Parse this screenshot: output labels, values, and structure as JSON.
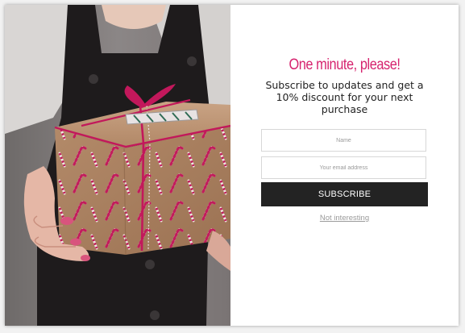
{
  "popup": {
    "headline": "One minute, please!",
    "subline": "Subscribe to updates and get a 10% discount for your next purchase",
    "name_field": {
      "placeholder": "Name",
      "value": ""
    },
    "email_field": {
      "placeholder": "Your email address",
      "value": ""
    },
    "subscribe_label": "SUBSCRIBE",
    "dismiss_label": "Not interesting"
  },
  "image": {
    "subject": "gift-box-photo",
    "icon": "gift-icon"
  },
  "colors": {
    "headline": "#d6246f",
    "button_bg": "#232323",
    "button_text": "#ffffff",
    "link": "#9a9a9a",
    "ribbon": "#c2185b",
    "wrapping_paper": "#b58d6c"
  }
}
